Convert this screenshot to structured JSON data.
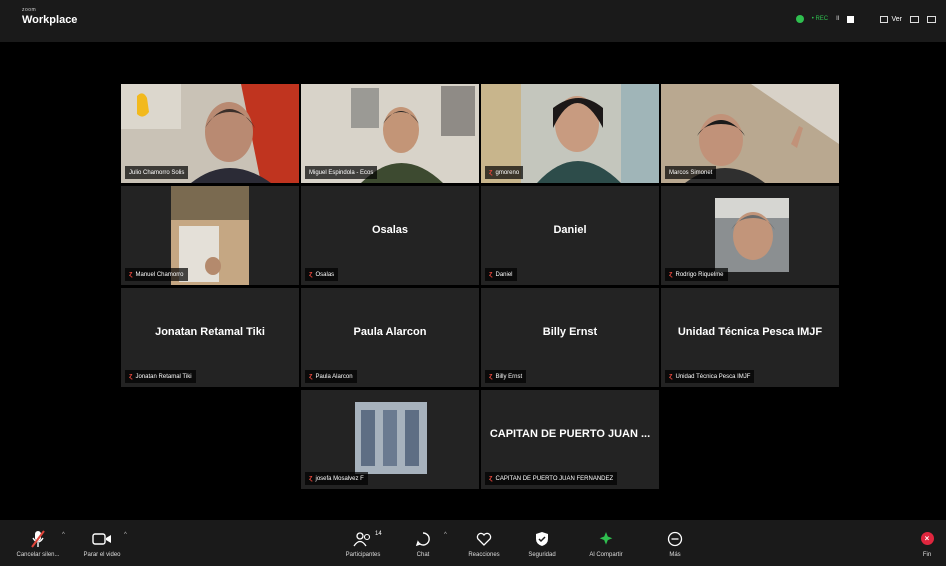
{
  "app": {
    "brand_sub": "zoom",
    "brand_name": "Workplace"
  },
  "topbar": {
    "rec_text": "• REC",
    "bars_text": "II",
    "view_label": "Ver"
  },
  "participants_grid": [
    {
      "name": "Julio Chamorro Solis",
      "muted": false,
      "video": true
    },
    {
      "name": "Miguel Espindola - Ecos",
      "muted": false,
      "video": true
    },
    {
      "name": "gmoreno",
      "muted": true,
      "video": true
    },
    {
      "name": "Marcos Simonet",
      "muted": false,
      "video": true
    },
    {
      "name": "Manuel Chamorro",
      "muted": true,
      "video": true
    },
    {
      "name": "Osalas",
      "display": "Osalas",
      "muted": true,
      "video": false
    },
    {
      "name": "Daniel",
      "display": "Daniel",
      "muted": true,
      "video": false
    },
    {
      "name": "Rodrigo Riquelme",
      "muted": true,
      "video": true
    },
    {
      "name": "Jonatan Retamal Tiki",
      "display": "Jonatan Retamal Tiki",
      "muted": true,
      "video": false
    },
    {
      "name": "Paula Alarcon",
      "display": "Paula Alarcon",
      "muted": true,
      "video": false
    },
    {
      "name": "Billy Ernst",
      "display": "Billy Ernst",
      "muted": true,
      "video": false
    },
    {
      "name": "Unidad Técnica Pesca IMJF",
      "display": "Unidad Técnica Pesca IMJF",
      "muted": true,
      "video": false
    },
    {
      "name": "josefa Mosalvez F",
      "muted": true,
      "video": true
    },
    {
      "name": "CAPITAN DE PUERTO JUAN FERNANDEZ",
      "display": "CAPITAN DE PUERTO JUAN ...",
      "muted": true,
      "video": false
    }
  ],
  "toolbar": {
    "mute_label": "Cancelar silen...",
    "video_label": "Parar el video",
    "participants_label": "Participantes",
    "participants_count": "14",
    "chat_label": "Chat",
    "reactions_label": "Reacciones",
    "security_label": "Seguridad",
    "share_label": "Al Compartir",
    "more_label": "Más",
    "end_label": "Fin"
  },
  "colors": {
    "muted_red": "#e0453a",
    "end_red": "#e0263e",
    "rec_green": "#2fbf4f",
    "share_green": "#2fbf4f"
  }
}
